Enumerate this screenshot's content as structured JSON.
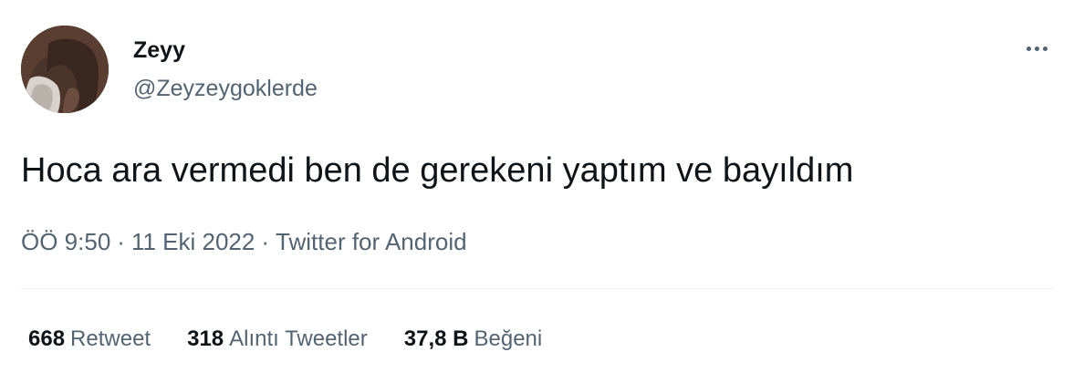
{
  "author": {
    "display_name": "Zeyy",
    "handle": "@Zeyzeygoklerde"
  },
  "header": {
    "more_icon": "more-horizontal-icon"
  },
  "tweet": {
    "text": "Hoca ara vermedi ben de gerekeni yaptım ve bayıldım"
  },
  "meta": {
    "time": "ÖÖ 9:50",
    "separator": "·",
    "date": "11 Eki 2022",
    "source": "Twitter for Android"
  },
  "stats": {
    "retweets": {
      "count": "668",
      "label": "Retweet"
    },
    "quotes": {
      "count": "318",
      "label": "Alıntı Tweetler"
    },
    "likes": {
      "count": "37,8 B",
      "label": "Beğeni"
    }
  },
  "colors": {
    "primary_text": "#0f1419",
    "secondary_text": "#536471",
    "divider": "#eff3f4"
  }
}
